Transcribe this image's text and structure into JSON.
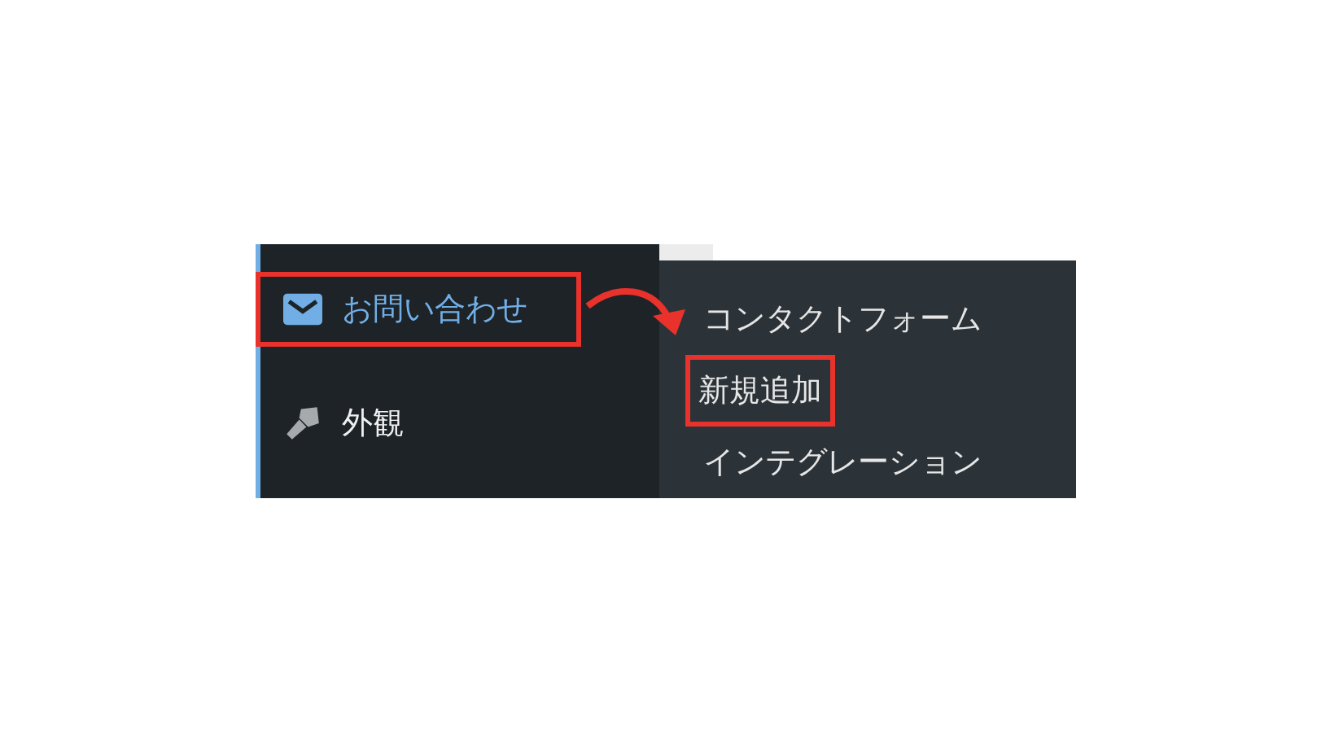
{
  "sidebar": {
    "items": [
      {
        "label": "お問い合わせ",
        "selected": true,
        "highlighted": true
      },
      {
        "label": "外観",
        "selected": false,
        "highlighted": false
      }
    ]
  },
  "submenu": {
    "items": [
      {
        "label": "コンタクトフォーム",
        "highlighted": false
      },
      {
        "label": "新規追加",
        "highlighted": true
      },
      {
        "label": "インテグレーション",
        "highlighted": false
      }
    ]
  }
}
